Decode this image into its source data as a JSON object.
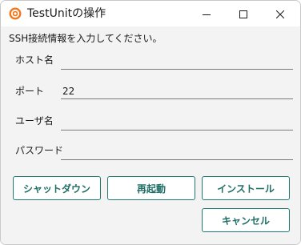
{
  "window": {
    "title": "TestUnitの操作",
    "icon": "orange-ring-app-icon",
    "controls": [
      "minimize-icon",
      "maximize-icon",
      "close-icon"
    ]
  },
  "instruction": "SSH接続情報を入力してください。",
  "form": {
    "host_label": "ホスト名",
    "host_value": "",
    "port_label": "ポート",
    "port_value": "22",
    "user_label": "ユーザ名",
    "user_value": "",
    "password_label": "パスワード",
    "password_value": ""
  },
  "buttons": {
    "shutdown": "シャットダウン",
    "restart": "再起動",
    "install": "インストール",
    "cancel": "キャンセル"
  },
  "colors": {
    "accent": "#1f7a72",
    "app_icon": "#f0781e"
  }
}
